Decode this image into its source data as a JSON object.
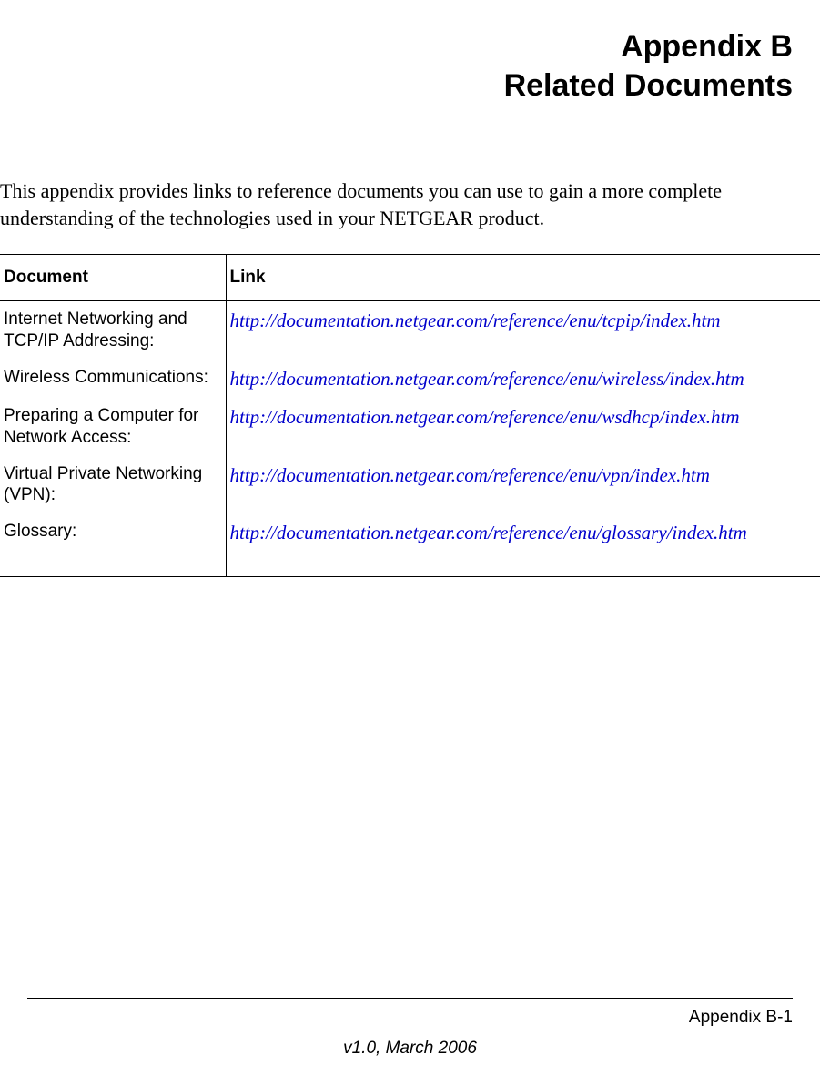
{
  "heading": {
    "line1": "Appendix B",
    "line2": "Related Documents"
  },
  "intro": "This appendix provides links to reference documents you can use to gain a more complete understanding of the technologies used in your NETGEAR product.",
  "table": {
    "headers": {
      "document": "Document",
      "link": "Link"
    },
    "rows": [
      {
        "document": "Internet Networking and TCP/IP Addressing:",
        "link": "http://documentation.netgear.com/reference/enu/tcpip/index.htm"
      },
      {
        "document": "Wireless Communications:",
        "link": "http://documentation.netgear.com/reference/enu/wireless/index.htm"
      },
      {
        "document": "Preparing a Computer for Network Access:",
        "link": "http://documentation.netgear.com/reference/enu/wsdhcp/index.htm"
      },
      {
        "document": "Virtual Private Networking (VPN):",
        "link": "http://documentation.netgear.com/reference/enu/vpn/index.htm"
      },
      {
        "document": "Glossary:",
        "link": "http://documentation.netgear.com/reference/enu/glossary/index.htm"
      }
    ]
  },
  "footer": {
    "page_label": "Appendix B-1",
    "version": "v1.0, March 2006"
  }
}
